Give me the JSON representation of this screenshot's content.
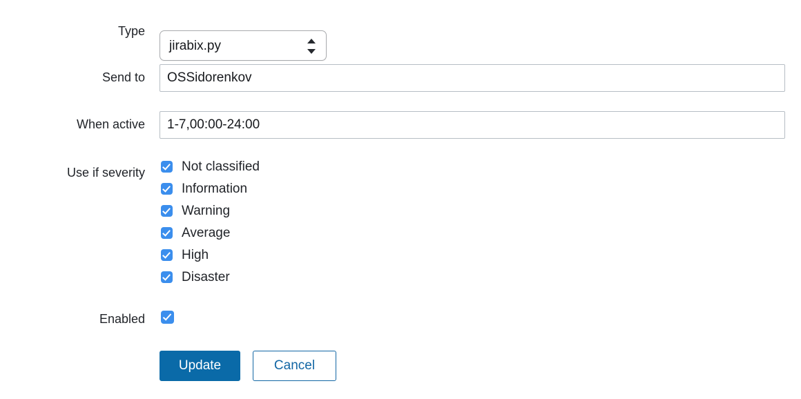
{
  "form": {
    "type": {
      "label": "Type",
      "selected": "jirabix.py",
      "icon": "select-stepper-icon"
    },
    "send_to": {
      "label": "Send to",
      "value": "OSSidorenkov",
      "placeholder": ""
    },
    "when_active": {
      "label": "When active",
      "value": "1-7,00:00-24:00",
      "placeholder": ""
    },
    "severity": {
      "label": "Use if severity",
      "options": [
        {
          "label": "Not classified",
          "checked": true
        },
        {
          "label": "Information",
          "checked": true
        },
        {
          "label": "Warning",
          "checked": true
        },
        {
          "label": "Average",
          "checked": true
        },
        {
          "label": "High",
          "checked": true
        },
        {
          "label": "Disaster",
          "checked": true
        }
      ]
    },
    "enabled": {
      "label": "Enabled",
      "checked": true
    },
    "buttons": {
      "submit_label": "Update",
      "cancel_label": "Cancel"
    }
  },
  "colors": {
    "accent_blue": "#0a6aa8",
    "link_blue": "#1266a4",
    "checkbox_blue": "#3b8eed",
    "text": "#1f2227",
    "input_border": "#b6bdc4",
    "select_border": "#a8aaad",
    "background": "#ffffff"
  }
}
